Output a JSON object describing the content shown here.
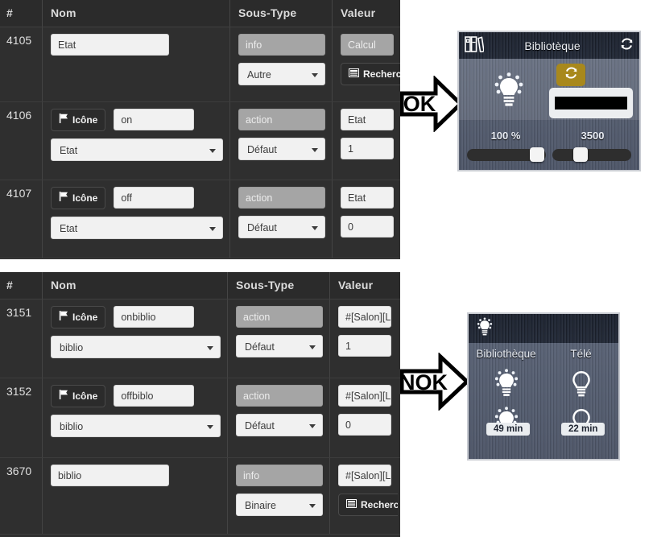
{
  "tables": [
    {
      "id": "table-top",
      "headers": [
        "#",
        "Nom",
        "Sous-Type",
        "Valeur"
      ],
      "rows": [
        {
          "id": "4105",
          "name_button": null,
          "name_input": "Etat",
          "name_select": null,
          "subtype_placeholder": "info",
          "subtype_select": "Autre",
          "value_placeholder": "Calcul",
          "value_input": null,
          "value_button": "Rechercher"
        },
        {
          "id": "4106",
          "name_button": "Icône",
          "name_input": "on",
          "name_select": "Etat",
          "subtype_placeholder": "action",
          "subtype_select": "Défaut",
          "value_placeholder": null,
          "value_input": "Etat",
          "value_second": "1",
          "value_button": null
        },
        {
          "id": "4107",
          "name_button": "Icône",
          "name_input": "off",
          "name_select": "Etat",
          "subtype_placeholder": "action",
          "subtype_select": "Défaut",
          "value_placeholder": null,
          "value_input": "Etat",
          "value_second": "0",
          "value_button": null
        }
      ]
    },
    {
      "id": "table-bottom",
      "headers": [
        "#",
        "Nom",
        "Sous-Type",
        "Valeur"
      ],
      "rows": [
        {
          "id": "3151",
          "name_button": "Icône",
          "name_input": "onbiblio",
          "name_select": "biblio",
          "subtype_placeholder": "action",
          "subtype_select": "Défaut",
          "value_placeholder": null,
          "value_input": "#[Salon][Lum",
          "value_second": "1",
          "value_button": null
        },
        {
          "id": "3152",
          "name_button": "Icône",
          "name_input": "offbiblo",
          "name_select": "biblio",
          "subtype_placeholder": "action",
          "subtype_select": "Défaut",
          "value_placeholder": null,
          "value_input": "#[Salon][Lum",
          "value_second": "0",
          "value_button": null
        },
        {
          "id": "3670",
          "name_button": null,
          "name_input": "biblio",
          "name_select": null,
          "subtype_placeholder": "info",
          "subtype_select": "Binaire",
          "value_placeholder": null,
          "value_input": "#[Salon][Lum",
          "value_button": "Rechercher"
        }
      ]
    }
  ],
  "annotations": {
    "ok_arrow_label": "OK",
    "nok_arrow_label": "NOK"
  },
  "widget_top": {
    "title": "Bibliotèque",
    "library_icon": "books-icon",
    "refresh_icon": "refresh-icon",
    "bulb_icon": "lightbulb-on-icon",
    "refresh_button_icon": "refresh-icon",
    "color_value": "#000000",
    "slider_brightness_label": "100 %",
    "slider_brightness_value": 100,
    "slider_temperature_label": "3500",
    "slider_temperature_value": 3500
  },
  "widget_bottom": {
    "header_icon": "lightbulb-on-icon",
    "columns": [
      {
        "label": "Bibliothèque",
        "bulb_top": "lightbulb-on-icon",
        "bulb_bottom": "lightbulb-on-icon",
        "badge": "49 min"
      },
      {
        "label": "Télé",
        "bulb_top": "lightbulb-off-icon",
        "bulb_bottom": "lightbulb-off-icon",
        "badge": "22 min"
      }
    ]
  },
  "colors": {
    "table_bg": "#2f2f2f",
    "input_bg": "#f1f1f1",
    "disabled_bg": "#a5a5a5",
    "gold_button": "#a8881c",
    "widget_title_bg": "#1e2431"
  }
}
